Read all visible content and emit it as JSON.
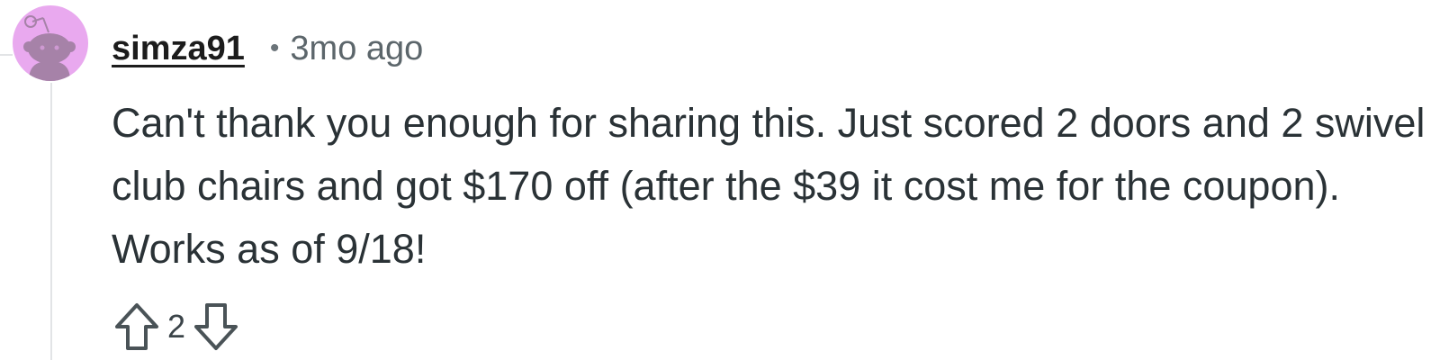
{
  "comment": {
    "username": "simza91",
    "separator": "•",
    "timestamp": "3mo ago",
    "body": "Can't thank you enough for sharing this. Just scored 2 doors and 2 swivel club chairs and got $170 off (after the $39 it cost me for the coupon). Works as of 9/18!",
    "score": "2",
    "icons": {
      "avatar": "snoo-avatar-icon",
      "upvote": "arrow-up-icon",
      "downvote": "arrow-down-icon"
    },
    "colors": {
      "avatar_bg": "#e9a9ef",
      "avatar_figure": "#a682a8",
      "thread_line": "#e2e4e6",
      "text": "#2a3236"
    }
  }
}
